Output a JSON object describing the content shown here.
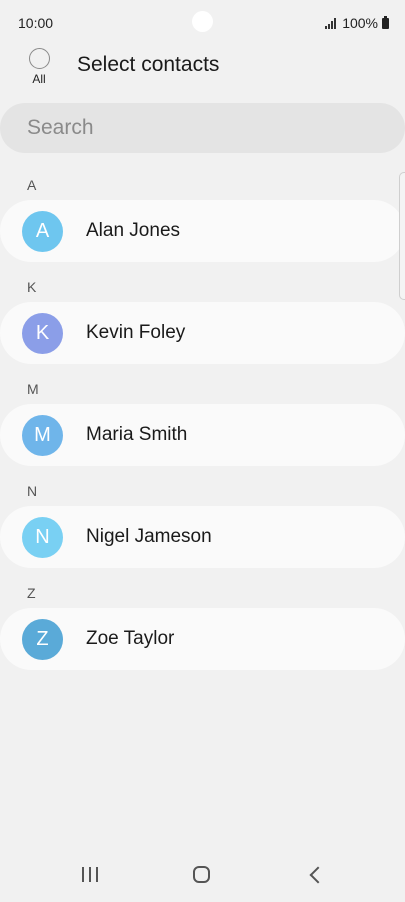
{
  "status_bar": {
    "time": "10:00",
    "battery": "100%"
  },
  "header": {
    "select_all_label": "All",
    "title": "Select contacts"
  },
  "search": {
    "placeholder": "Search",
    "value": ""
  },
  "sections": [
    {
      "letter": "A",
      "contacts": [
        {
          "initial": "A",
          "name": "Alan Jones",
          "avatar_color": "#6ec6ef"
        }
      ]
    },
    {
      "letter": "K",
      "contacts": [
        {
          "initial": "K",
          "name": "Kevin Foley",
          "avatar_color": "#8b9ee8"
        }
      ]
    },
    {
      "letter": "M",
      "contacts": [
        {
          "initial": "M",
          "name": "Maria Smith",
          "avatar_color": "#6fb5ea"
        }
      ]
    },
    {
      "letter": "N",
      "contacts": [
        {
          "initial": "N",
          "name": "Nigel Jameson",
          "avatar_color": "#79d0f3"
        }
      ]
    },
    {
      "letter": "Z",
      "contacts": [
        {
          "initial": "Z",
          "name": "Zoe Taylor",
          "avatar_color": "#5aaad8"
        }
      ]
    }
  ],
  "nav_bar": {
    "recent_icon": "recent-apps-icon",
    "home_icon": "home-icon",
    "back_icon": "back-icon"
  }
}
